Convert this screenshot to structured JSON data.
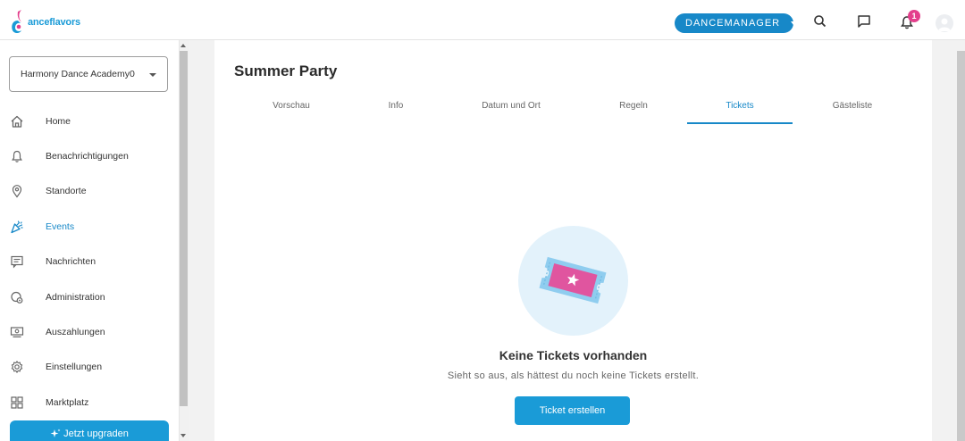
{
  "app": {
    "logo_text": "anceflavors"
  },
  "topbar": {
    "role_button": "DANCEMANAGER",
    "notification_count": "1",
    "icons": [
      "search-icon",
      "chat-icon",
      "bell-icon",
      "user-avatar"
    ]
  },
  "sidebar": {
    "school": "Harmony Dance Academy0",
    "items": [
      {
        "label": "Home",
        "icon": "home-icon",
        "active": false
      },
      {
        "label": "Benachrichtigungen",
        "icon": "bell-icon",
        "active": false
      },
      {
        "label": "Standorte",
        "icon": "location-pin-icon",
        "active": false
      },
      {
        "label": "Events",
        "icon": "party-popper-icon",
        "active": true
      },
      {
        "label": "Nachrichten",
        "icon": "message-icon",
        "active": false
      },
      {
        "label": "Administration",
        "icon": "admin-icon",
        "active": false
      },
      {
        "label": "Auszahlungen",
        "icon": "payout-icon",
        "active": false
      },
      {
        "label": "Einstellungen",
        "icon": "gear-icon",
        "active": false
      },
      {
        "label": "Marktplatz",
        "icon": "grid-icon",
        "active": false
      }
    ],
    "upgrade_label": "Jetzt upgraden"
  },
  "main": {
    "title": "Summer Party",
    "tabs": [
      {
        "label": "Vorschau",
        "active": false
      },
      {
        "label": "Info",
        "active": false
      },
      {
        "label": "Datum und Ort",
        "active": false
      },
      {
        "label": "Regeln",
        "active": false
      },
      {
        "label": "Tickets",
        "active": true
      },
      {
        "label": "Gästeliste",
        "active": false
      }
    ],
    "empty_state": {
      "title": "Keine Tickets vorhanden",
      "subtitle": "Sieht so aus, als hättest du noch keine Tickets erstellt.",
      "button": "Ticket erstellen"
    }
  },
  "colors": {
    "accent": "#1788c8",
    "button": "#1a9bd7",
    "badge": "#e33f8c",
    "ticket_pink": "#e0559f"
  }
}
